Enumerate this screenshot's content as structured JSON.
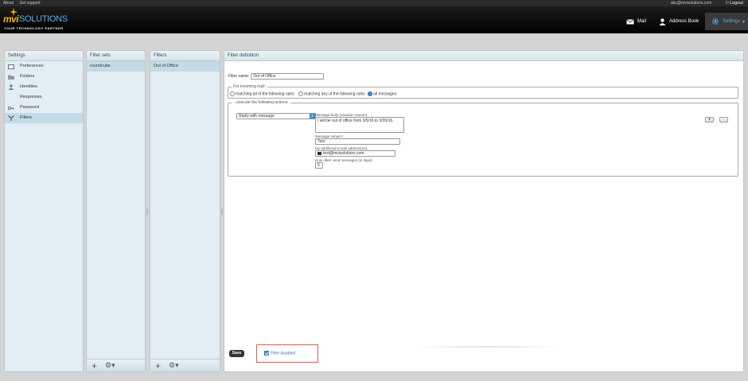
{
  "topbar": {
    "links": [
      "About",
      "Get support"
    ],
    "user": "abc@mvisolutions.com",
    "logout": "Logout"
  },
  "logo": {
    "brand_a": "mvi",
    "brand_b": "SOLUTIONS",
    "tagline": "YOUR TECHNOLOGY PARTNER"
  },
  "nav": {
    "mail": "Mail",
    "address_book": "Address Book",
    "settings": "Settings"
  },
  "settings_panel": {
    "title": "Settings",
    "items": [
      {
        "label": "Preferences",
        "icon": "preferences-icon"
      },
      {
        "label": "Folders",
        "icon": "folder-icon"
      },
      {
        "label": "Identities",
        "icon": "person-icon"
      },
      {
        "label": "Responses",
        "icon": ""
      },
      {
        "label": "Password",
        "icon": "key-icon"
      },
      {
        "label": "Filters",
        "icon": "filter-icon"
      }
    ],
    "selected": "Filters"
  },
  "filter_sets": {
    "title": "Filter sets",
    "items": [
      "roundcube"
    ]
  },
  "filters": {
    "title": "Filters",
    "items": [
      "Out of Office"
    ]
  },
  "definition": {
    "title": "Filter definition",
    "name_label": "Filter name:",
    "name_value": "Out of Office",
    "incoming_legend": "For incoming mail:",
    "rule_all": "matching all of the following rules",
    "rule_any": "matching any of the following rules",
    "rule_messages": "all messages",
    "actions_legend": "...execute the following actions:",
    "action_select": "Reply with message",
    "body_label": "Message body (vacation reason):",
    "body_value": "I will be out of office from 3/5/16 to 3/20/16.",
    "subject_label": "Message subject:",
    "subject_value": "Test",
    "addresses_label": "My additional e-mail address(es):",
    "address_value": "test@mvisolutions.com",
    "days_label": "How often send messages (in days):",
    "days_value": "5",
    "add_btn": "+",
    "remove_btn": "−",
    "save": "Save",
    "disabled_label": "Filter disabled"
  },
  "colors": {
    "accent": "#3d8fd8",
    "highlight": "#e05a4a",
    "panel": "#e2eef3"
  }
}
